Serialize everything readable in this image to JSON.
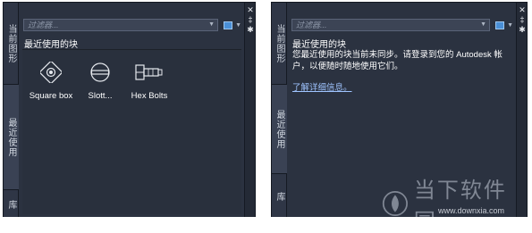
{
  "left_panel": {
    "tabs": [
      "当前图形",
      "最近使用",
      "库"
    ],
    "filter_placeholder": "过滤器...",
    "section_title": "最近使用的块",
    "blocks": [
      {
        "name": "Square box",
        "icon": "square-box-icon"
      },
      {
        "name": "Slott...",
        "icon": "slotted-circle-icon"
      },
      {
        "name": "Hex Bolts",
        "icon": "hex-bolt-icon"
      }
    ]
  },
  "right_panel": {
    "tabs": [
      "当前图形",
      "最近使用",
      "库"
    ],
    "filter_placeholder": "过滤器...",
    "section_title": "最近使用的块",
    "message": "您最近使用的块当前未同步。请登录到您的 Autodesk 帐户，以便随时随地使用它们。",
    "link": "了解详细信息。"
  },
  "strip_icons": [
    "close-icon",
    "auto-hide-icon",
    "properties-icon"
  ],
  "watermark": {
    "text": "当下软件园",
    "url": "www.downxia.com"
  },
  "colors": {
    "panel_bg": "#2b3240",
    "link": "#9fc4ff",
    "view_button": "#4a8fd6"
  }
}
